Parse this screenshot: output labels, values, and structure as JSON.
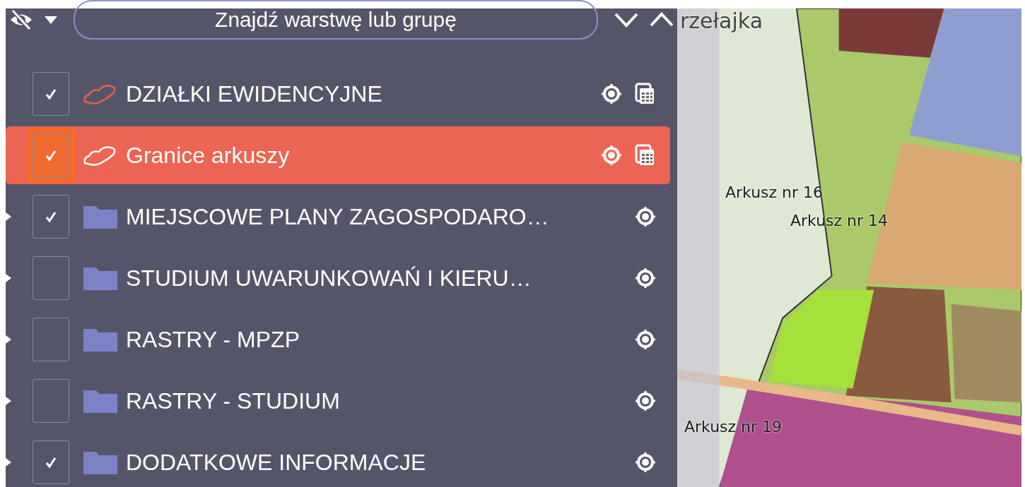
{
  "toolbar": {
    "search": {
      "placeholder": "Znajdź warstwę lub grupę"
    }
  },
  "layers": [
    {
      "kind": "layer",
      "label": "DZIAŁKI EWIDENCYJNE",
      "checked": true,
      "selected": false,
      "focused": false
    },
    {
      "kind": "layer",
      "label": "Granice arkuszy",
      "checked": true,
      "selected": true,
      "focused": true
    },
    {
      "kind": "group",
      "label": "MIEJSCOWE PLANY ZAGOSPODARO…",
      "checked": true,
      "selected": false,
      "focused": false
    },
    {
      "kind": "group",
      "label": "STUDIUM UWARUNKOWAŃ I KIERU…",
      "checked": false,
      "selected": false,
      "focused": false
    },
    {
      "kind": "group",
      "label": "RASTRY - MPZP",
      "checked": false,
      "selected": false,
      "focused": false
    },
    {
      "kind": "group",
      "label": "RASTRY - STUDIUM",
      "checked": false,
      "selected": false,
      "focused": false
    },
    {
      "kind": "group",
      "label": "DODATKOWE INFORMACJE",
      "checked": true,
      "selected": false,
      "focused": false
    }
  ],
  "map": {
    "labels": [
      "rzełajka",
      "Arkusz nr 16",
      "Arkusz nr 14",
      "Arkusz nr 19"
    ]
  }
}
